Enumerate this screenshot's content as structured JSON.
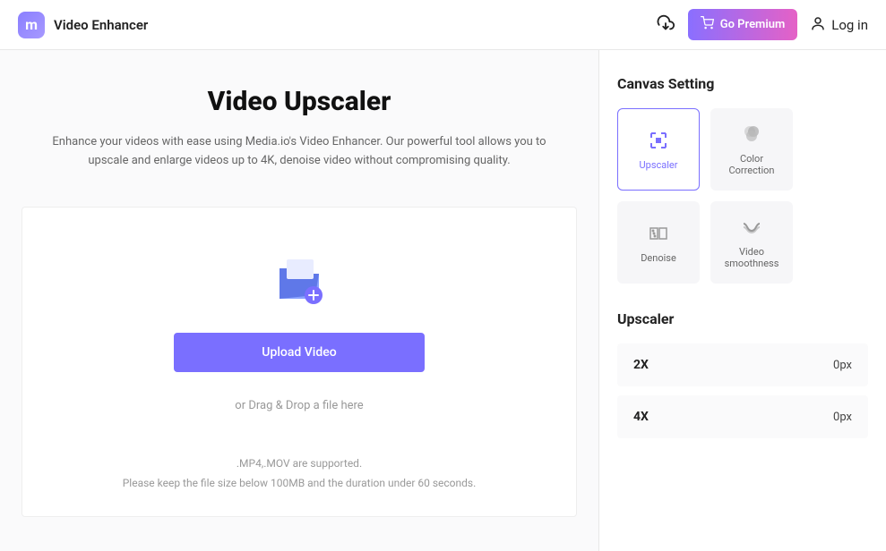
{
  "header": {
    "app_title": "Video Enhancer",
    "premium_label": "Go Premium",
    "login_label": "Log in"
  },
  "main": {
    "title": "Video Upscaler",
    "description": "Enhance your videos with ease using Media.io's Video Enhancer. Our powerful tool allows you to upscale and enlarge videos up to 4K, denoise video without compromising quality.",
    "upload_button": "Upload Video",
    "drag_text": "or Drag & Drop a file here",
    "support_text": ".MP4,.MOV are supported.",
    "limit_text": "Please keep the file size below 100MB and the duration under 60 seconds."
  },
  "sidebar": {
    "canvas_title": "Canvas Setting",
    "tiles": [
      {
        "label": "Upscaler"
      },
      {
        "label": "Color Correction"
      },
      {
        "label": "Denoise"
      },
      {
        "label": "Video smoothness"
      }
    ],
    "upscaler_title": "Upscaler",
    "scales": [
      {
        "label": "2X",
        "value": "0px"
      },
      {
        "label": "4X",
        "value": "0px"
      }
    ]
  }
}
